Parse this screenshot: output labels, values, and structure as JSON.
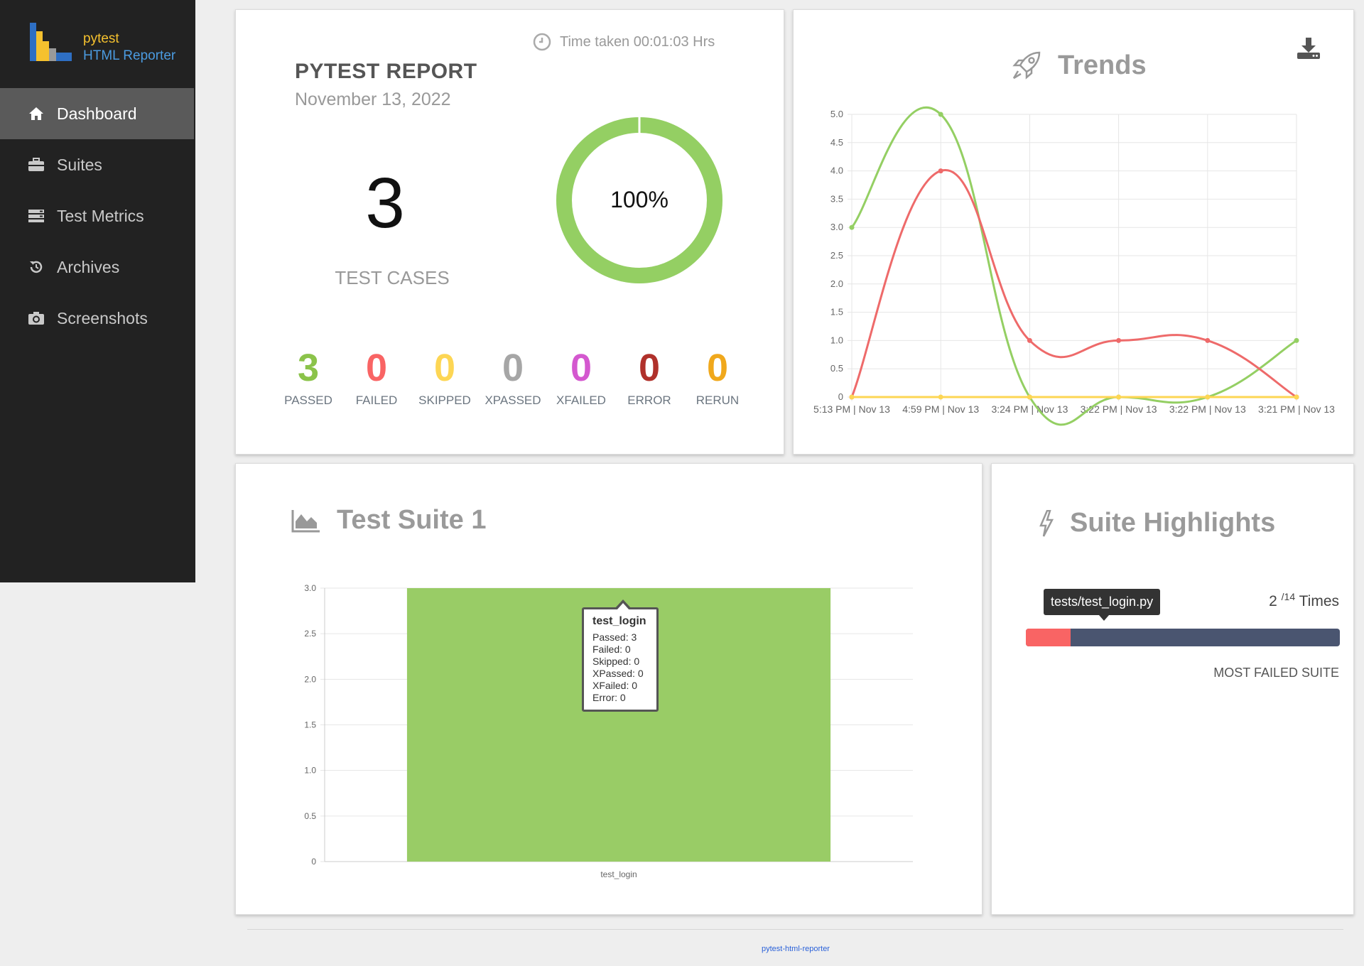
{
  "brand": {
    "line1": "pytest",
    "line2": "HTML Reporter"
  },
  "sidebar": {
    "items": [
      {
        "label": "Dashboard",
        "icon": "home-icon",
        "active": true
      },
      {
        "label": "Suites",
        "icon": "briefcase-icon"
      },
      {
        "label": "Test Metrics",
        "icon": "server-icon"
      },
      {
        "label": "Archives",
        "icon": "history-icon"
      },
      {
        "label": "Screenshots",
        "icon": "camera-icon"
      }
    ]
  },
  "report": {
    "time_taken": "Time taken 00:01:03 Hrs",
    "title": "PYTEST REPORT",
    "date": "November 13, 2022",
    "total": "3",
    "total_label": "TEST CASES",
    "pass_percent": "100%",
    "pass_fraction": 1.0,
    "stats": [
      {
        "value": "3",
        "label": "PASSED",
        "color": "#8bc34a"
      },
      {
        "value": "0",
        "label": "FAILED",
        "color": "#f96464"
      },
      {
        "value": "0",
        "label": "SKIPPED",
        "color": "#fdd654"
      },
      {
        "value": "0",
        "label": "XPASSED",
        "color": "#a6a6a6"
      },
      {
        "value": "0",
        "label": "XFAILED",
        "color": "#d458cf"
      },
      {
        "value": "0",
        "label": "ERROR",
        "color": "#b0312b"
      },
      {
        "value": "0",
        "label": "RERUN",
        "color": "#f0a81c"
      }
    ]
  },
  "trends": {
    "title": "Trends",
    "download_icon": "download-icon"
  },
  "suite": {
    "title": "Test Suite 1"
  },
  "tooltip": {
    "title": "test_login",
    "lines": [
      "Passed: 3",
      "Failed: 0",
      "Skipped: 0",
      "XPassed: 0",
      "XFailed: 0",
      "Error: 0"
    ]
  },
  "highlights": {
    "title": "Suite Highlights",
    "suite_name": "tests/test_login.py",
    "count": "2",
    "total": "/14",
    "times_label": "Times",
    "fail_fraction": 0.143,
    "subtitle": "MOST FAILED SUITE"
  },
  "footer": {
    "text": "pytest-html-reporter"
  },
  "chart_data": [
    {
      "type": "line",
      "title": "Trends",
      "x": [
        "5:13 PM | Nov 13",
        "4:59 PM | Nov 13",
        "3:24 PM | Nov 13",
        "3:22 PM | Nov 13",
        "3:22 PM | Nov 13",
        "3:21 PM | Nov 13"
      ],
      "ylim": [
        0,
        5
      ],
      "yticks": [
        "0",
        "0.5",
        "1.0",
        "1.5",
        "2.0",
        "2.5",
        "3.0",
        "3.5",
        "4.0",
        "4.5",
        "5.0"
      ],
      "grid": true,
      "series": [
        {
          "color": "#94cf63",
          "values": [
            3,
            5,
            0,
            0,
            0,
            1
          ]
        },
        {
          "color": "#ee6a6a",
          "values": [
            0,
            4,
            1,
            1,
            1,
            0
          ]
        },
        {
          "color": "#fdd654",
          "values": [
            0,
            0,
            0,
            0,
            0,
            0
          ]
        }
      ]
    },
    {
      "type": "bar",
      "title": "Test Suite 1",
      "categories": [
        "test_login"
      ],
      "ylim": [
        0,
        3
      ],
      "yticks": [
        "0",
        "0.5",
        "1.0",
        "1.5",
        "2.0",
        "2.5",
        "3.0"
      ],
      "series": [
        {
          "color": "#99cc66",
          "values": [
            3
          ]
        }
      ]
    }
  ]
}
